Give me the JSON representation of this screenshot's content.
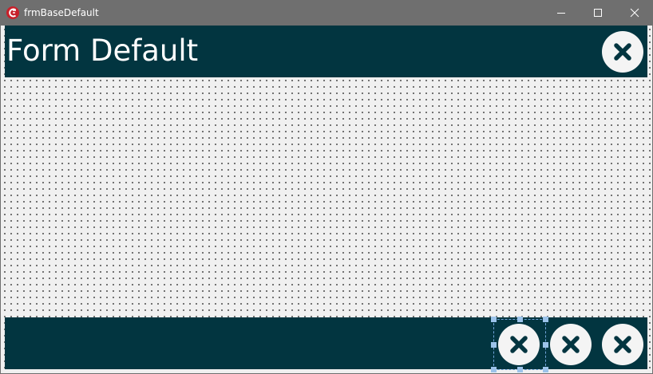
{
  "window": {
    "title": "frmBaseDefault",
    "controls": {
      "minimize_icon": "minimize-icon",
      "maximize_icon": "maximize-icon",
      "close_icon": "close-icon"
    }
  },
  "form": {
    "title": "Form Default",
    "header_close_icon": "close-circle-icon",
    "footer_buttons": [
      {
        "icon": "close-circle-icon",
        "selected": true
      },
      {
        "icon": "close-circle-icon",
        "selected": false
      },
      {
        "icon": "close-circle-icon",
        "selected": false
      }
    ]
  },
  "colors": {
    "titlebar": "#6f6f6f",
    "panel": "#023540",
    "canvas": "#f0f0f0",
    "button_face": "#f4f4f4",
    "button_glyph": "#023540",
    "selection": "#9cc3ea"
  }
}
